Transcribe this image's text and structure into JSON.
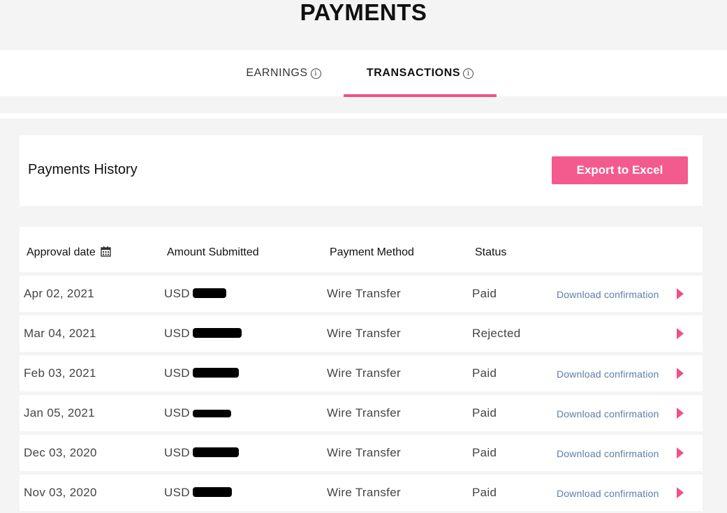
{
  "page": {
    "title": "PAYMENTS"
  },
  "tabs": [
    {
      "label": "EARNINGS",
      "active": false
    },
    {
      "label": "TRANSACTIONS",
      "active": true
    }
  ],
  "history": {
    "title": "Payments History",
    "export_label": "Export to Excel"
  },
  "table": {
    "columns": [
      "Approval date",
      "Amount Submitted",
      "Payment Method",
      "Status"
    ],
    "rows": [
      {
        "date": "Apr 02, 2021",
        "currency": "USD",
        "method": "Wire Transfer",
        "status": "Paid",
        "action": "Download confirmation"
      },
      {
        "date": "Mar 04, 2021",
        "currency": "USD",
        "method": "Wire Transfer",
        "status": "Rejected",
        "action": ""
      },
      {
        "date": "Feb 03, 2021",
        "currency": "USD",
        "method": "Wire Transfer",
        "status": "Paid",
        "action": "Download confirmation"
      },
      {
        "date": "Jan 05, 2021",
        "currency": "USD",
        "method": "Wire Transfer",
        "status": "Paid",
        "action": "Download confirmation"
      },
      {
        "date": "Dec 03, 2020",
        "currency": "USD",
        "method": "Wire Transfer",
        "status": "Paid",
        "action": "Download confirmation"
      },
      {
        "date": "Nov 03, 2020",
        "currency": "USD",
        "method": "Wire Transfer",
        "status": "Paid",
        "action": "Download confirmation"
      }
    ]
  },
  "colors": {
    "accent": "#f0508a",
    "button": "#f35b8e",
    "link": "#5b7fa6"
  },
  "icons": {
    "info": "info-icon",
    "calendar": "calendar-icon",
    "row_arrow": "caret-right-icon"
  }
}
